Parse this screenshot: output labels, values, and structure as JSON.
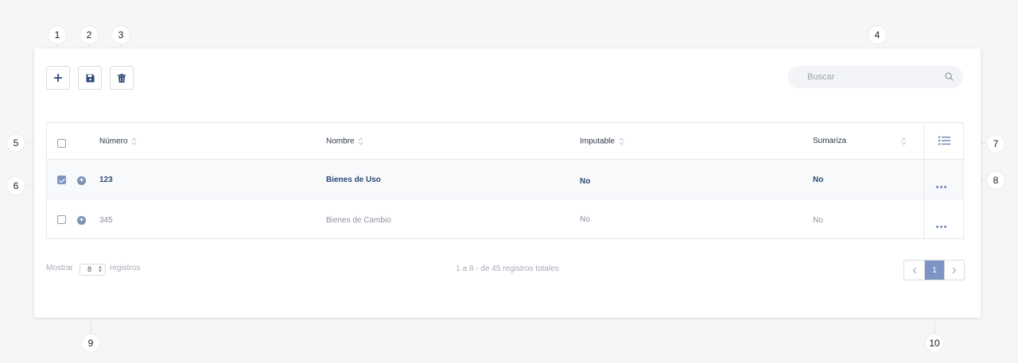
{
  "toolbar": {
    "add_icon": "plus-icon",
    "save_icon": "floppy-disk-icon",
    "delete_icon": "trash-icon"
  },
  "search": {
    "placeholder": "Buscar",
    "icon": "search-icon"
  },
  "table": {
    "columns": [
      {
        "label": "Número",
        "sortable": true
      },
      {
        "label": "Nombre",
        "sortable": true
      },
      {
        "label": "Imputable",
        "sortable": true
      },
      {
        "label": "Sumariza",
        "sortable": true
      }
    ],
    "column_menu_icon": "list-icon",
    "rows": [
      {
        "checked": true,
        "numero": "123",
        "nombre": "Bienes de Uso",
        "imputable": "No",
        "sumariza": "No"
      },
      {
        "checked": false,
        "numero": "345",
        "nombre": "Bienes de Cambio",
        "imputable": "No",
        "sumariza": "No"
      }
    ],
    "row_actions_icon": "more-dots-icon"
  },
  "footer": {
    "show_label": "Mostrar",
    "page_size": "8",
    "records_label": "registros",
    "summary": "1 a 8 - de 45 registros totales",
    "current_page": "1"
  },
  "callouts": [
    "1",
    "2",
    "3",
    "4",
    "5",
    "6",
    "7",
    "8",
    "9",
    "10"
  ],
  "colors": {
    "accent": "#7d95c4",
    "dark_text": "#2c4a74",
    "background": "#f6f6f6"
  }
}
